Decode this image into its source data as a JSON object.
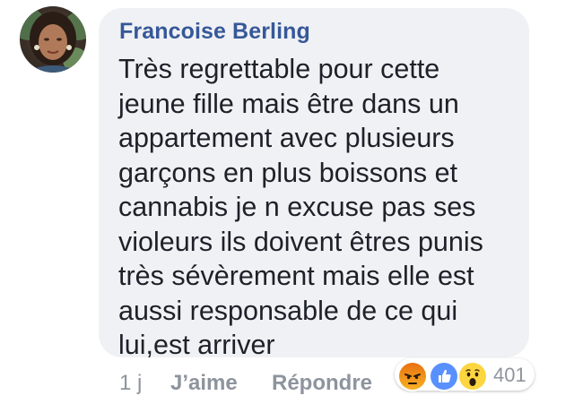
{
  "comment": {
    "author": "Francoise Berling",
    "text": "Très regrettable pour cette\njeune fille mais être dans un\nappartement avec plusieurs\ngarçons en plus boissons et\ncannabis je n excuse pas ses\nvioleurs ils doivent êtres punis\ntrès sévèrement mais elle est\naussi responsable de ce qui\nlui,est arriver"
  },
  "actions": {
    "time": "1 j",
    "like_label": "J’aime",
    "reply_label": "Répondre"
  },
  "reactions": {
    "icons": [
      "angry-icon",
      "like-icon",
      "wow-icon"
    ],
    "count": "401"
  },
  "colors": {
    "author": "#365899",
    "text": "#1d2129",
    "bubble": "#f0f1f4",
    "actions": "#8d949e",
    "like_blue": "#5890ff",
    "angry_top": "#e9710f",
    "wow_yellow": "#fcd640"
  }
}
